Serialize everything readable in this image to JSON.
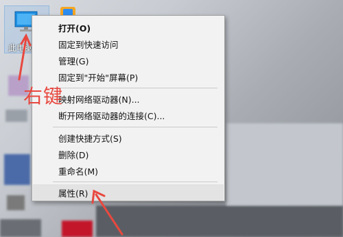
{
  "desktop": {
    "icon_label": "此电脑"
  },
  "context_menu": {
    "items": [
      {
        "label": "打开(O)"
      },
      {
        "label": "固定到快速访问"
      },
      {
        "label": "管理(G)"
      },
      {
        "label": "固定到\"开始\"屏幕(P)"
      },
      {
        "label": "映射网络驱动器(N)..."
      },
      {
        "label": "断开网络驱动器的连接(C)..."
      },
      {
        "label": "创建快捷方式(S)"
      },
      {
        "label": "删除(D)"
      },
      {
        "label": "重命名(M)"
      },
      {
        "label": "属性(R)"
      }
    ]
  },
  "annotation": {
    "text": "右键",
    "color": "#e8483f"
  }
}
